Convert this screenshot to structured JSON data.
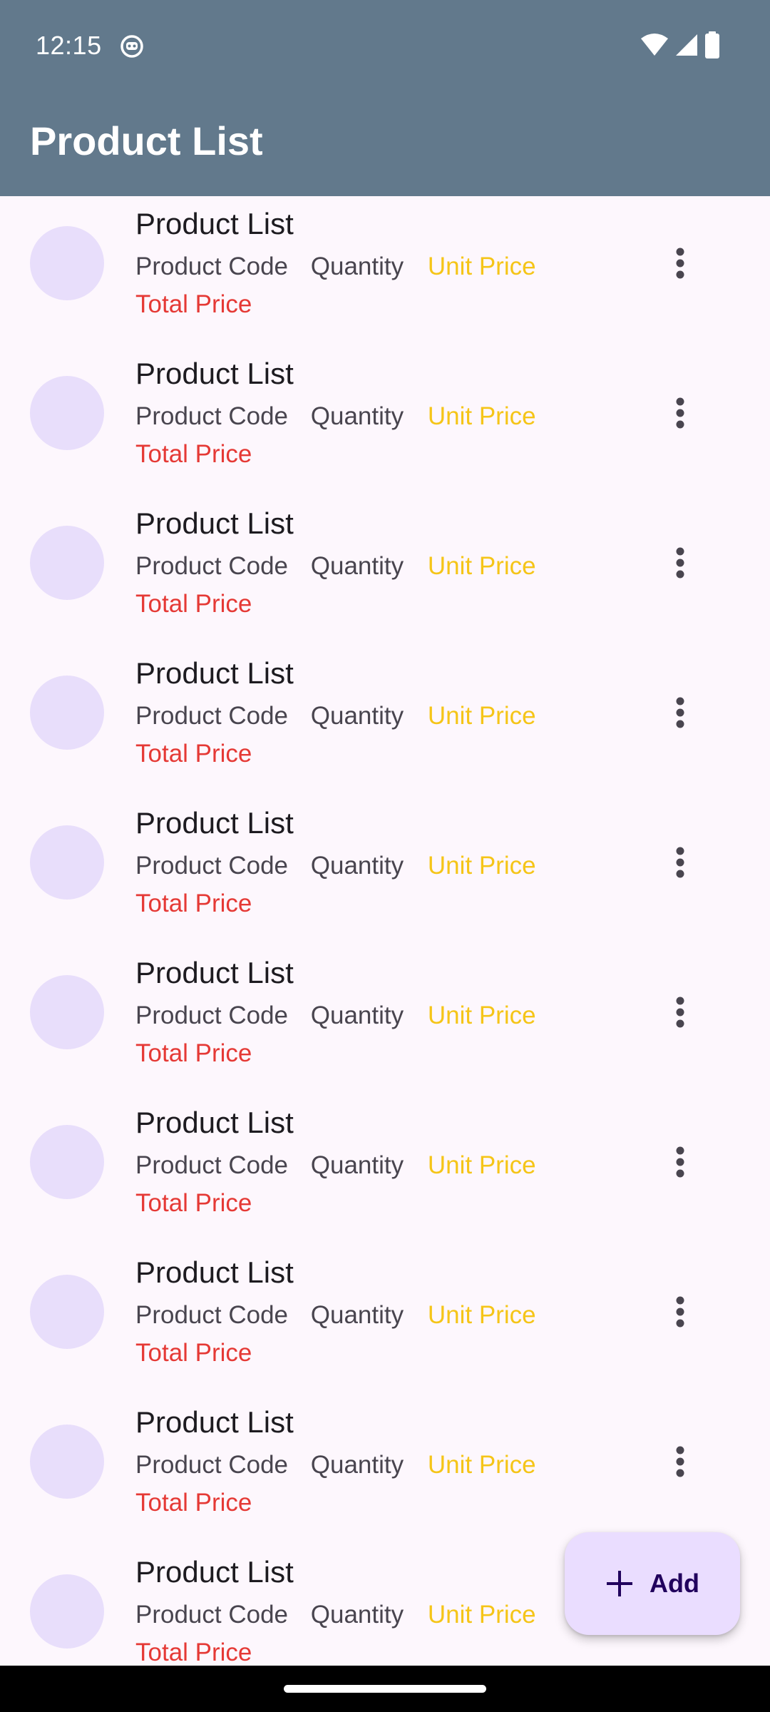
{
  "status_bar": {
    "time": "12:15",
    "icons": [
      "app-notification-icon",
      "wifi-icon",
      "signal-icon",
      "battery-icon"
    ]
  },
  "app_bar": {
    "title": "Product List"
  },
  "colors": {
    "app_bar": "#62798c",
    "background": "#fdf7fd",
    "avatar": "#e8defb",
    "unit_price": "#f5c518",
    "total_price": "#e53935",
    "fab": "#eaddff"
  },
  "list": {
    "items": [
      {
        "title": "Product List",
        "code": "Product Code",
        "quantity": "Quantity",
        "unit_price": "Unit Price",
        "total_price": "Total Price"
      },
      {
        "title": "Product List",
        "code": "Product Code",
        "quantity": "Quantity",
        "unit_price": "Unit Price",
        "total_price": "Total Price"
      },
      {
        "title": "Product List",
        "code": "Product Code",
        "quantity": "Quantity",
        "unit_price": "Unit Price",
        "total_price": "Total Price"
      },
      {
        "title": "Product List",
        "code": "Product Code",
        "quantity": "Quantity",
        "unit_price": "Unit Price",
        "total_price": "Total Price"
      },
      {
        "title": "Product List",
        "code": "Product Code",
        "quantity": "Quantity",
        "unit_price": "Unit Price",
        "total_price": "Total Price"
      },
      {
        "title": "Product List",
        "code": "Product Code",
        "quantity": "Quantity",
        "unit_price": "Unit Price",
        "total_price": "Total Price"
      },
      {
        "title": "Product List",
        "code": "Product Code",
        "quantity": "Quantity",
        "unit_price": "Unit Price",
        "total_price": "Total Price"
      },
      {
        "title": "Product List",
        "code": "Product Code",
        "quantity": "Quantity",
        "unit_price": "Unit Price",
        "total_price": "Total Price"
      },
      {
        "title": "Product List",
        "code": "Product Code",
        "quantity": "Quantity",
        "unit_price": "Unit Price",
        "total_price": "Total Price"
      },
      {
        "title": "Product List",
        "code": "Product Code",
        "quantity": "Quantity",
        "unit_price": "Unit Price",
        "total_price": "Total Price"
      }
    ]
  },
  "fab": {
    "label": "Add",
    "icon": "plus-icon"
  }
}
